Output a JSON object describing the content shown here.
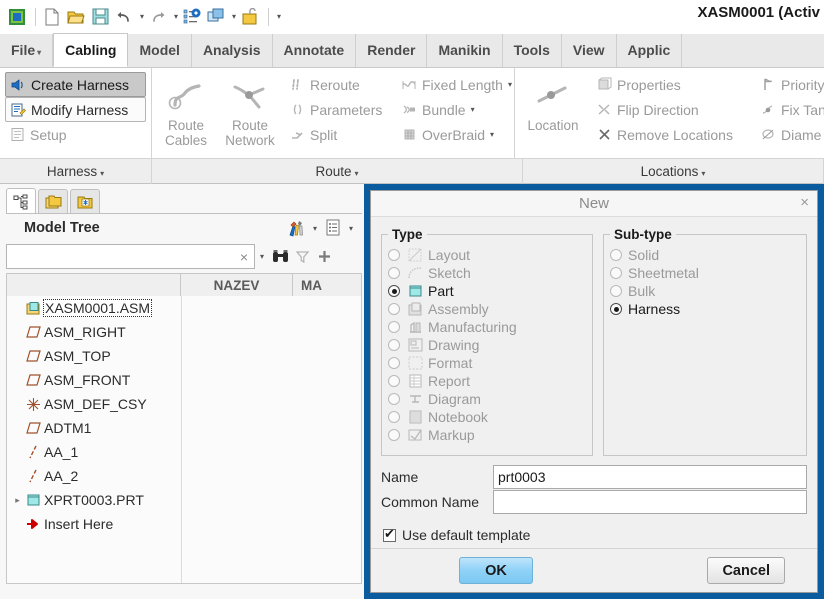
{
  "window": {
    "title": "XASM0001 (Activ"
  },
  "quick_access": {
    "icons": [
      {
        "name": "app-logo-icon"
      },
      {
        "name": "new-file-icon"
      },
      {
        "name": "open-folder-icon"
      },
      {
        "name": "save-icon"
      },
      {
        "name": "undo-icon"
      },
      {
        "name": "undo-dropdown-caret"
      },
      {
        "name": "redo-icon"
      },
      {
        "name": "redo-dropdown-caret"
      },
      {
        "name": "regenerate-icon"
      },
      {
        "name": "window-manager-icon"
      },
      {
        "name": "window-dropdown-caret"
      },
      {
        "name": "close-window-icon"
      },
      {
        "name": "customize-qat-caret"
      }
    ]
  },
  "tabs": [
    {
      "label": "File",
      "active": false,
      "has_caret": true
    },
    {
      "label": "Cabling",
      "active": true,
      "has_caret": false
    },
    {
      "label": "Model",
      "active": false,
      "has_caret": false
    },
    {
      "label": "Analysis",
      "active": false,
      "has_caret": false
    },
    {
      "label": "Annotate",
      "active": false,
      "has_caret": false
    },
    {
      "label": "Render",
      "active": false,
      "has_caret": false
    },
    {
      "label": "Manikin",
      "active": false,
      "has_caret": false
    },
    {
      "label": "Tools",
      "active": false,
      "has_caret": false
    },
    {
      "label": "View",
      "active": false,
      "has_caret": false
    },
    {
      "label": "Applic",
      "active": false,
      "has_caret": false
    }
  ],
  "ribbon": {
    "harness": {
      "label": "Harness",
      "buttons": [
        {
          "label": "Create Harness",
          "icon": "create-harness-icon",
          "state": "pressed"
        },
        {
          "label": "Modify Harness",
          "icon": "modify-harness-icon",
          "state": "outlined"
        },
        {
          "label": "Setup",
          "icon": "setup-icon",
          "state": "disabled"
        }
      ]
    },
    "route": {
      "label": "Route",
      "large_buttons": [
        {
          "label": "Route\nCables",
          "line1": "Route",
          "line2": "Cables",
          "icon": "route-cables-icon"
        },
        {
          "label": "Route\nNetwork",
          "line1": "Route",
          "line2": "Network",
          "icon": "route-network-icon"
        }
      ],
      "small_col1": [
        {
          "label": "Reroute",
          "icon": "reroute-icon"
        },
        {
          "label": "Parameters",
          "icon": "parameters-icon"
        },
        {
          "label": "Split",
          "icon": "split-icon"
        }
      ],
      "small_col2": [
        {
          "label": "Fixed Length",
          "icon": "fixed-length-icon",
          "caret": true
        },
        {
          "label": "Bundle",
          "icon": "bundle-icon",
          "caret": true
        },
        {
          "label": "OverBraid",
          "icon": "overbraid-icon",
          "caret": true
        }
      ]
    },
    "locations": {
      "label": "Locations",
      "large_buttons": [
        {
          "label": "Location",
          "line1": "Location",
          "line2": "",
          "icon": "location-icon"
        }
      ],
      "small_col1": [
        {
          "label": "Properties",
          "icon": "properties-icon"
        },
        {
          "label": "Flip Direction",
          "icon": "flip-direction-icon"
        },
        {
          "label": "Remove Locations",
          "icon": "remove-locations-icon"
        }
      ],
      "small_col2": [
        {
          "label": "Priority",
          "icon": "priority-icon"
        },
        {
          "label": "Fix Tan",
          "icon": "fix-tangent-icon"
        },
        {
          "label": "Diame",
          "icon": "diameter-icon"
        }
      ]
    }
  },
  "model_tree": {
    "tabs": [
      {
        "name": "model-tree-tab",
        "icon": "tree-structure-icon",
        "active": true
      },
      {
        "name": "folder-browser-tab",
        "icon": "folders-icon",
        "active": false
      },
      {
        "name": "favorites-tab",
        "icon": "favorites-folder-icon",
        "active": false
      }
    ],
    "title": "Model Tree",
    "header_icons": [
      {
        "name": "tree-filter-tools-icon"
      },
      {
        "name": "tree-filter-caret"
      },
      {
        "name": "tree-columns-icon"
      },
      {
        "name": "tree-columns-caret"
      }
    ],
    "search": {
      "value": "",
      "placeholder": "",
      "clear_label": "×"
    },
    "search_icons": [
      {
        "name": "search-history-caret"
      },
      {
        "name": "find-binoculars-icon"
      },
      {
        "name": "filter-funnel-icon"
      },
      {
        "name": "add-plus-icon"
      }
    ],
    "columns": [
      "",
      "NAZEV",
      "MA"
    ],
    "rows": [
      {
        "label": "XASM0001.ASM",
        "icon": "assembly-icon",
        "level": 0,
        "expander": "",
        "selected": true
      },
      {
        "label": "ASM_RIGHT",
        "icon": "datum-plane-icon",
        "level": 1,
        "expander": "",
        "selected": false
      },
      {
        "label": "ASM_TOP",
        "icon": "datum-plane-icon",
        "level": 1,
        "expander": "",
        "selected": false
      },
      {
        "label": "ASM_FRONT",
        "icon": "datum-plane-icon",
        "level": 1,
        "expander": "",
        "selected": false
      },
      {
        "label": "ASM_DEF_CSY",
        "icon": "coordinate-system-icon",
        "level": 1,
        "expander": "",
        "selected": false
      },
      {
        "label": "ADTM1",
        "icon": "datum-plane-icon",
        "level": 1,
        "expander": "",
        "selected": false
      },
      {
        "label": "AA_1",
        "icon": "datum-axis-icon",
        "level": 1,
        "expander": "",
        "selected": false
      },
      {
        "label": "AA_2",
        "icon": "datum-axis-icon",
        "level": 1,
        "expander": "",
        "selected": false
      },
      {
        "label": "XPRT0003.PRT",
        "icon": "part-icon",
        "level": 0,
        "expander": "▸",
        "selected": false
      },
      {
        "label": "Insert Here",
        "icon": "insert-here-icon",
        "level": 1,
        "expander": "",
        "selected": false
      }
    ]
  },
  "dialog": {
    "title": "New",
    "close_label": "×",
    "type_group": {
      "legend": "Type",
      "options": [
        {
          "label": "Layout",
          "icon": "layout-icon",
          "checked": false,
          "enabled": false
        },
        {
          "label": "Sketch",
          "icon": "sketch-icon",
          "checked": false,
          "enabled": false
        },
        {
          "label": "Part",
          "icon": "part-icon",
          "checked": true,
          "enabled": true
        },
        {
          "label": "Assembly",
          "icon": "assembly-icon",
          "checked": false,
          "enabled": false
        },
        {
          "label": "Manufacturing",
          "icon": "manufacturing-icon",
          "checked": false,
          "enabled": false
        },
        {
          "label": "Drawing",
          "icon": "drawing-icon",
          "checked": false,
          "enabled": false
        },
        {
          "label": "Format",
          "icon": "format-icon",
          "checked": false,
          "enabled": false
        },
        {
          "label": "Report",
          "icon": "report-icon",
          "checked": false,
          "enabled": false
        },
        {
          "label": "Diagram",
          "icon": "diagram-icon",
          "checked": false,
          "enabled": false
        },
        {
          "label": "Notebook",
          "icon": "notebook-icon",
          "checked": false,
          "enabled": false
        },
        {
          "label": "Markup",
          "icon": "markup-icon",
          "checked": false,
          "enabled": false
        }
      ]
    },
    "subtype_group": {
      "legend": "Sub-type",
      "options": [
        {
          "label": "Solid",
          "checked": false,
          "enabled": false
        },
        {
          "label": "Sheetmetal",
          "checked": false,
          "enabled": false
        },
        {
          "label": "Bulk",
          "checked": false,
          "enabled": false
        },
        {
          "label": "Harness",
          "checked": true,
          "enabled": true
        }
      ]
    },
    "fields": [
      {
        "label": "Name",
        "value": "prt0003",
        "placeholder": ""
      },
      {
        "label": "Common Name",
        "value": "",
        "placeholder": ""
      }
    ],
    "checkbox": {
      "label": "Use default template",
      "checked": true
    },
    "buttons": {
      "ok": "OK",
      "cancel": "Cancel"
    }
  },
  "colors": {
    "dialog_frame_blue": "#0b5c9e",
    "ok_button_blue": "#8fd2f7",
    "tab_active_bg": "#ffffff",
    "ribbon_bg": "#ffffff",
    "group_label_bg": "#eeeeee",
    "tree_bg": "#fbfbfb",
    "cable_yellow": "#ffe000"
  }
}
